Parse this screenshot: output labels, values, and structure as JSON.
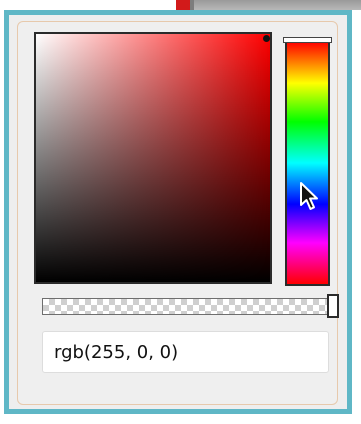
{
  "color_picker": {
    "hue_color": "#ff0000",
    "selected_color": "#ff0000",
    "hue_position": 0,
    "saturation": 1,
    "brightness": 1,
    "alpha": 1,
    "value": "rgb(255, 0, 0)"
  },
  "colors": {
    "frame_border": "#5fb7c6",
    "panel_background": "#eeeeee",
    "accent_swatch": "#d21a1a"
  },
  "icons": {
    "cursor": "arrow-pointer-icon"
  }
}
